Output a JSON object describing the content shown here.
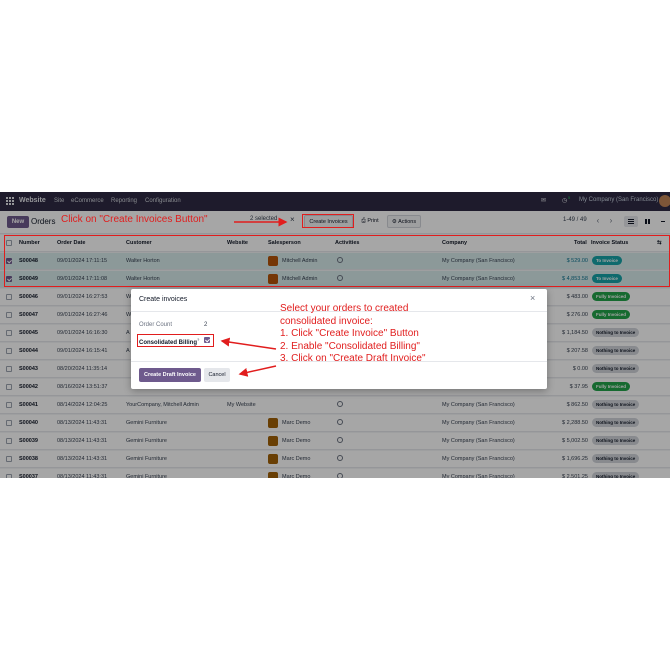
{
  "topbar": {
    "app_name": "Website",
    "menu": [
      "Site",
      "eCommerce",
      "Reporting",
      "Configuration"
    ],
    "notif_count": "5",
    "company": "My Company (San Francisco)"
  },
  "control": {
    "new_label": "New",
    "breadcrumb": "Orders",
    "selected_label": "2 selected",
    "create_invoices_label": "Create Invoices",
    "print_label": "Print",
    "actions_label": "Actions",
    "pager": "1-49 / 49"
  },
  "annotations": {
    "step_top": "Click on \"Create Invoices Button\"",
    "instructions": [
      "Select your orders to created",
      "consolidated invoice:",
      "1. Click \"Create Invoice\" Button",
      "2. Enable \"Consolidated Billing\"",
      "3. Click on \"Create Draft Invoice\""
    ]
  },
  "table": {
    "headers": {
      "number": "Number",
      "order_date": "Order Date",
      "customer": "Customer",
      "website": "Website",
      "salesperson": "Salesperson",
      "activities": "Activities",
      "company": "Company",
      "total": "Total",
      "invoice_status": "Invoice Status"
    },
    "rows": [
      {
        "selected": true,
        "number": "S00048",
        "date": "09/01/2024 17:11:15",
        "customer": "Walter Horton",
        "website": "",
        "salesperson": "Mitchell Admin",
        "avatar": "mitchell",
        "activity": true,
        "company": "My Company (San Francisco)",
        "total": "$ 529.00",
        "status": "To Invoice",
        "status_kind": "to"
      },
      {
        "selected": true,
        "number": "S00049",
        "date": "09/01/2024 17:11:08",
        "customer": "Walter Horton",
        "website": "",
        "salesperson": "Mitchell Admin",
        "avatar": "mitchell",
        "activity": true,
        "company": "My Company (San Francisco)",
        "total": "$ 4,853.58",
        "status": "To Invoice",
        "status_kind": "to"
      },
      {
        "selected": false,
        "number": "S00046",
        "date": "09/01/2024 16:27:53",
        "customer": "W",
        "website": "",
        "salesperson": "",
        "avatar": "",
        "activity": false,
        "company": "",
        "total": "$ 483.00",
        "status": "Fully Invoiced",
        "status_kind": "full"
      },
      {
        "selected": false,
        "number": "S00047",
        "date": "09/01/2024 16:27:46",
        "customer": "W",
        "website": "",
        "salesperson": "",
        "avatar": "",
        "activity": false,
        "company": "",
        "total": "$ 276.00",
        "status": "Fully Invoiced",
        "status_kind": "full"
      },
      {
        "selected": false,
        "number": "S00045",
        "date": "09/01/2024 16:16:30",
        "customer": "A",
        "website": "",
        "salesperson": "",
        "avatar": "",
        "activity": false,
        "company": "",
        "total": "$ 1,184.50",
        "status": "Nothing to Invoice",
        "status_kind": "none"
      },
      {
        "selected": false,
        "number": "S00044",
        "date": "09/01/2024 16:15:41",
        "customer": "A",
        "website": "",
        "salesperson": "",
        "avatar": "",
        "activity": false,
        "company": "",
        "total": "$ 207.58",
        "status": "Nothing to Invoice",
        "status_kind": "none"
      },
      {
        "selected": false,
        "number": "S00043",
        "date": "08/20/2024 11:35:14",
        "customer": "",
        "website": "",
        "salesperson": "",
        "avatar": "",
        "activity": false,
        "company": "",
        "total": "$ 0.00",
        "status": "Nothing to Invoice",
        "status_kind": "none"
      },
      {
        "selected": false,
        "number": "S00042",
        "date": "08/16/2024 13:51:37",
        "customer": "",
        "website": "",
        "salesperson": "",
        "avatar": "",
        "activity": false,
        "company": "",
        "total": "$ 37.95",
        "status": "Fully Invoiced",
        "status_kind": "full"
      },
      {
        "selected": false,
        "number": "S00041",
        "date": "08/14/2024 12:04:25",
        "customer": "YourCompany, Mitchell Admin",
        "website": "My Website",
        "salesperson": "",
        "avatar": "",
        "activity": true,
        "company": "My Company (San Francisco)",
        "total": "$ 862.50",
        "status": "Nothing to Invoice",
        "status_kind": "none"
      },
      {
        "selected": false,
        "number": "S00040",
        "date": "08/13/2024 11:43:31",
        "customer": "Gemini Furniture",
        "website": "",
        "salesperson": "Marc Demo",
        "avatar": "marc",
        "activity": true,
        "company": "My Company (San Francisco)",
        "total": "$ 2,288.50",
        "status": "Nothing to Invoice",
        "status_kind": "none"
      },
      {
        "selected": false,
        "number": "S00039",
        "date": "08/13/2024 11:43:31",
        "customer": "Gemini Furniture",
        "website": "",
        "salesperson": "Marc Demo",
        "avatar": "marc",
        "activity": true,
        "company": "My Company (San Francisco)",
        "total": "$ 5,002.50",
        "status": "Nothing to Invoice",
        "status_kind": "none"
      },
      {
        "selected": false,
        "number": "S00038",
        "date": "08/13/2024 11:43:31",
        "customer": "Gemini Furniture",
        "website": "",
        "salesperson": "Marc Demo",
        "avatar": "marc",
        "activity": true,
        "company": "My Company (San Francisco)",
        "total": "$ 1,696.25",
        "status": "Nothing to Invoice",
        "status_kind": "none"
      },
      {
        "selected": false,
        "number": "S00037",
        "date": "08/13/2024 11:43:31",
        "customer": "Gemini Furniture",
        "website": "",
        "salesperson": "Marc Demo",
        "avatar": "marc",
        "activity": true,
        "company": "My Company (San Francisco)",
        "total": "$ 2,501.25",
        "status": "Nothing to Invoice",
        "status_kind": "none"
      }
    ]
  },
  "modal": {
    "title": "Create invoices",
    "order_count_label": "Order Count",
    "order_count_value": "2",
    "consolidated_label": "Consolidated Billing",
    "consolidated_help": "?",
    "create_draft_label": "Create Draft Invoice",
    "cancel_label": "Cancel",
    "close": "×"
  },
  "colors": {
    "topbar": "#2e2a44",
    "primary": "#6e5a8d",
    "selected_row": "#d7ebec",
    "annotation": "#e11d1d",
    "to_invoice": "#16a4a8",
    "fully_invoiced": "#22a34a"
  },
  "icons": {
    "apps": "grid-icon",
    "print": "printer-icon",
    "actions": "gear-icon",
    "close": "close-icon",
    "activity": "clock-icon"
  }
}
